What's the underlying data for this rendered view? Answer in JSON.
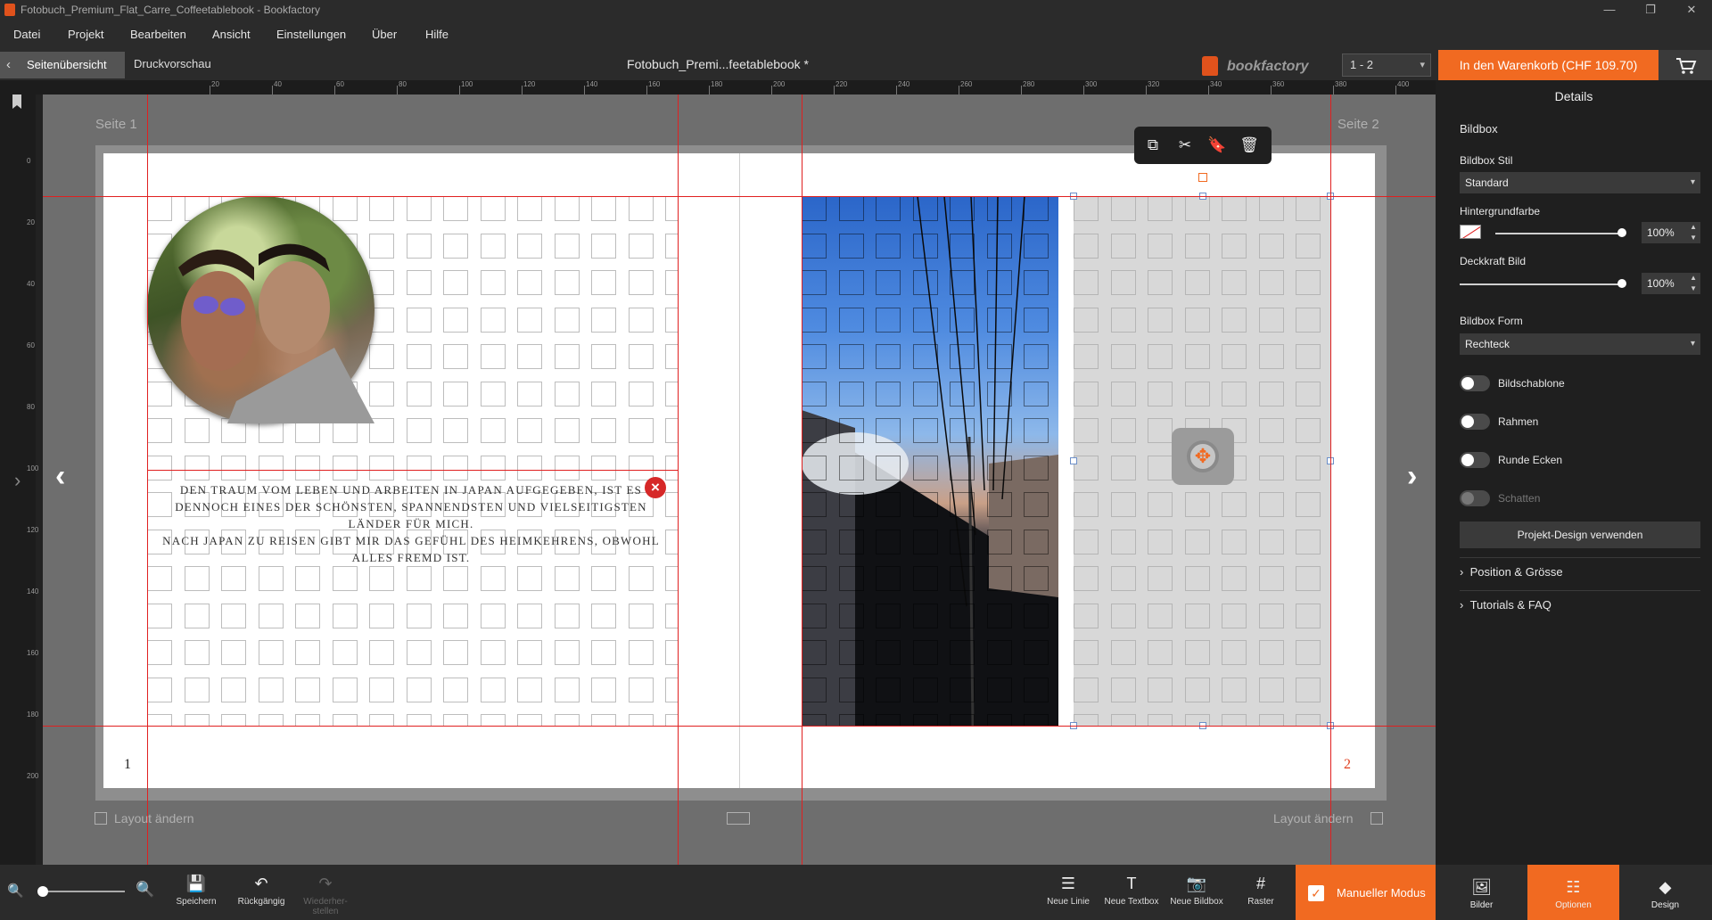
{
  "window": {
    "title": "Fotobuch_Premium_Flat_Carre_Coffeetablebook - Bookfactory",
    "controls": [
      "—",
      "❐",
      "✕"
    ]
  },
  "menu": [
    "Datei",
    "Projekt",
    "Bearbeiten",
    "Ansicht",
    "Einstellungen",
    "Über",
    "Hilfe"
  ],
  "nav": {
    "back_label": "Seitenübersicht",
    "preview_label": "Druckvorschau",
    "doc_title": "Fotobuch_Premi...feetablebook *",
    "brand": "bookfactory",
    "page_range": "1 - 2",
    "cart_label": "In den Warenkorb (CHF 109.70)"
  },
  "ruler": {
    "top_labels": [
      "20",
      "40",
      "60",
      "80",
      "100",
      "120",
      "140",
      "160",
      "180",
      "200",
      "220",
      "240",
      "260",
      "280",
      "300",
      "320",
      "340",
      "360",
      "380",
      "400"
    ],
    "left_labels": [
      "0",
      "20",
      "40",
      "60",
      "80",
      "100",
      "120",
      "140",
      "160",
      "180",
      "200"
    ]
  },
  "canvas": {
    "left_page_label": "Seite 1",
    "right_page_label": "Seite 2",
    "left_page_number": "1",
    "right_page_number": "2",
    "text_block": [
      "Den Traum vom Leben und Arbeiten in Japan aufgegeben, ist es",
      "dennoch eines der schönsten, spannendsten und vielseitigsten",
      "Länder für mich.",
      "Nach Japan zu reisen gibt mir das Gefühl des Heimkehrens, obwohl",
      "alles fremd ist."
    ],
    "layout_left": "Layout ändern",
    "layout_right": "Layout ändern"
  },
  "floating_toolbar": {
    "icons": [
      "copy-icon",
      "scissors-icon",
      "bookmark-add-icon",
      "trash-icon"
    ]
  },
  "bottom_toolbar": {
    "save": "Speichern",
    "undo": "Rückgängig",
    "redo": "Wiederher-stellen",
    "new_line": "Neue Linie",
    "new_textbox": "Neue Textbox",
    "new_imagebox": "Neue Bildbox",
    "grid": "Raster",
    "manual_mode": "Manueller Modus"
  },
  "details": {
    "header": "Details",
    "section_title": "Bildbox",
    "style_label": "Bildbox Stil",
    "style_value": "Standard",
    "bg_label": "Hintergrundfarbe",
    "bg_percent": "100%",
    "opacity_label": "Deckkraft Bild",
    "opacity_percent": "100%",
    "shape_label": "Bildbox Form",
    "shape_value": "Rechteck",
    "toggles": [
      "Bildschablone",
      "Rahmen",
      "Runde Ecken",
      "Schatten"
    ],
    "project_design_btn": "Projekt-Design verwenden",
    "section_position": "Position & Grösse",
    "section_tutorials": "Tutorials & FAQ"
  },
  "right_tabs": {
    "images": "Bilder",
    "options": "Optionen",
    "design": "Design"
  },
  "colors": {
    "accent": "#f16a21",
    "guide": "#e02020"
  }
}
